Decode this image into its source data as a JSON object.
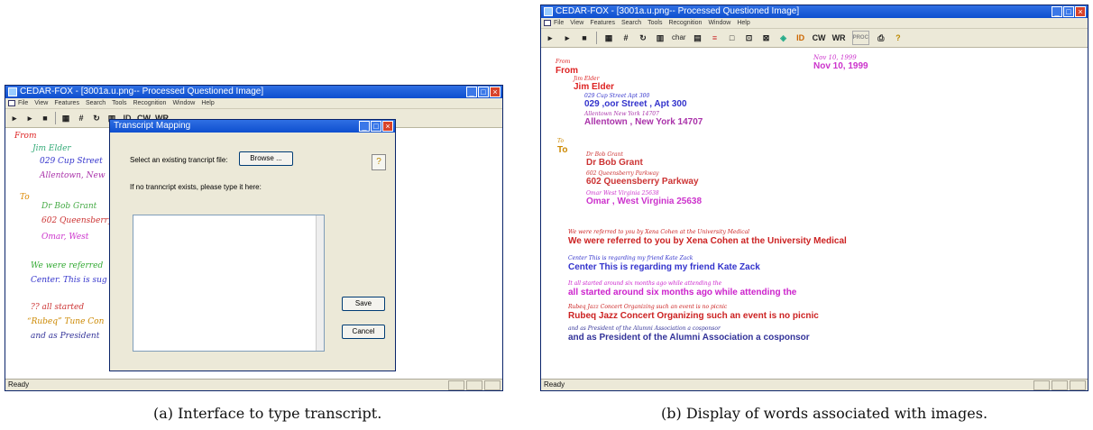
{
  "left": {
    "title": "CEDAR-FOX - [3001a.u.png-- Processed Questioned Image]",
    "menu": [
      "File",
      "View",
      "Features",
      "Search",
      "Tools",
      "Recognition",
      "Window",
      "Help"
    ],
    "tools": [
      "ID",
      "CW",
      "WR"
    ],
    "status": "Ready",
    "handwriting": [
      {
        "text": "From",
        "color": "#d22"
      },
      {
        "text": "Jim Elder",
        "color": "#3a7"
      },
      {
        "text": "029 Cup Street",
        "color": "#33c"
      },
      {
        "text": "Allentown, New",
        "color": "#a3a"
      },
      {
        "text": "To",
        "color": "#d80"
      },
      {
        "text": "Dr Bob Grant",
        "color": "#4a4"
      },
      {
        "text": "602 Queensberry",
        "color": "#c33"
      },
      {
        "text": "Omar, West",
        "color": "#c3c"
      },
      {
        "text": "We were referred",
        "color": "#3a3"
      },
      {
        "text": "Center. This is sug",
        "color": "#33c"
      },
      {
        "text": "?? all started",
        "color": "#c33"
      },
      {
        "text": "“Rubeq” Tune Con",
        "color": "#c80"
      },
      {
        "text": "and as President",
        "color": "#339"
      }
    ],
    "dialog": {
      "title": "Transcript Mapping",
      "select_label": "Select an existing trancript file:",
      "browse_label": "Browse ...",
      "type_label": "If no tranncript exists, please type it here:",
      "transcript_text": "",
      "save_label": "Save",
      "cancel_label": "Cancel"
    },
    "caption": "(a) Interface to type transcript."
  },
  "right": {
    "title": "CEDAR-FOX - [3001a.u.png-- Processed Questioned Image]",
    "menu": [
      "File",
      "View",
      "Features",
      "Search",
      "Tools",
      "Recognition",
      "Window",
      "Help"
    ],
    "tools": [
      "char",
      "ID",
      "CW",
      "WR",
      "PROC"
    ],
    "status": "Ready",
    "date_hw": "Nov 10, 1999",
    "date_word": "Nov 10, 1999",
    "words": [
      {
        "hw": "From",
        "typed": "From",
        "color": "#d22"
      },
      {
        "hw": "Jim Elder",
        "typed": "Jim Elder",
        "color": "#d22"
      },
      {
        "hw": "029 Cup Street Apt 300",
        "typed": "029 ,oor Street , Apt 300",
        "color": "#33c"
      },
      {
        "hw": "Allentown New York 14707",
        "typed": "Allentown , New York 14707",
        "color": "#a3a"
      },
      {
        "hw": "To",
        "typed": "To",
        "color": "#c80"
      },
      {
        "hw": "Dr Bob Grant",
        "typed": "Dr Bob Grant",
        "color": "#c33"
      },
      {
        "hw": "602 Queensberry Parkway",
        "typed": "602 Queensberry Parkway",
        "color": "#c33"
      },
      {
        "hw": "Omar West Virginia 25638",
        "typed": "Omar , West Virginia 25638",
        "color": "#c3c"
      },
      {
        "hw": "We were referred to you by Xena Cohen at the University Medical",
        "typed": "We were referred to you by Xena Cohen at the University Medical",
        "color": "#c22"
      },
      {
        "hw": "Center This is regarding my friend Kate Zack",
        "typed": "Center This is regarding my friend Kate Zack",
        "color": "#33c"
      },
      {
        "hw": "It all started around six months ago while attending the",
        "typed": "all started around six months ago while attending the",
        "color": "#c2c"
      },
      {
        "hw": "Rubeq Jazz Concert Organizing such an event is no picnic",
        "typed": "Rubeq Jazz Concert Organizing such an event is no picnic",
        "color": "#c22"
      },
      {
        "hw": "and as President of the Alumni Association a cosponsor",
        "typed": "and as President of the Alumni Association a cosponsor",
        "color": "#339"
      }
    ],
    "caption": "(b) Display of words associated with images."
  }
}
